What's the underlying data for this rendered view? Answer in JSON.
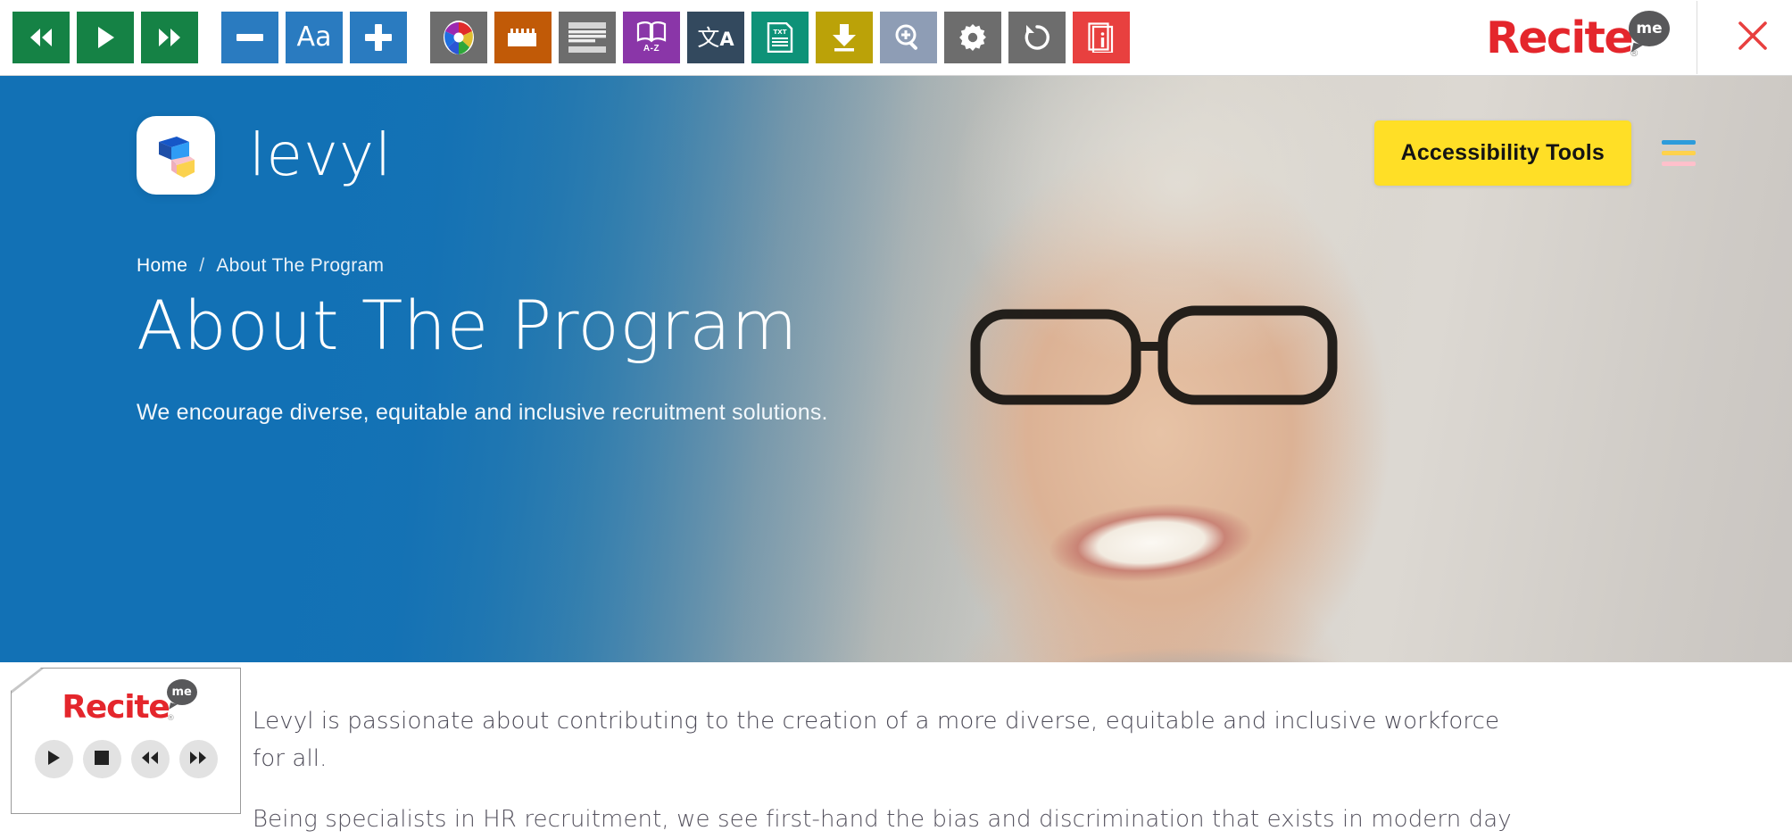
{
  "toolbar": {
    "name": "recite-me-accessibility-toolbar",
    "buttons": [
      {
        "key": "rewind",
        "label": "Rewind",
        "icon": "rewind-icon",
        "color": "#158245"
      },
      {
        "key": "play",
        "label": "Play",
        "icon": "play-icon",
        "color": "#158245"
      },
      {
        "key": "forward",
        "label": "Forward",
        "icon": "fast-forward-icon",
        "color": "#158245"
      },
      {
        "key": "decrease_text",
        "label": "Decrease Text Size",
        "icon": "minus-icon",
        "color": "#2a7bc0"
      },
      {
        "key": "font",
        "label": "Aa",
        "icon": "font-aa-icon",
        "color": "#2a7bc0"
      },
      {
        "key": "increase_text",
        "label": "Increase Text Size",
        "icon": "plus-icon",
        "color": "#2a7bc0"
      },
      {
        "key": "colour",
        "label": "Change Colour",
        "icon": "colour-wheel-icon",
        "color": "#6d6d6d"
      },
      {
        "key": "ruler",
        "label": "Ruler",
        "icon": "ruler-icon",
        "color": "#c15a07"
      },
      {
        "key": "screen_mask",
        "label": "Screen Mask",
        "icon": "screen-mask-icon",
        "color": "#6d6d6d"
      },
      {
        "key": "dictionary",
        "label": "Dictionary",
        "icon": "dictionary-book-icon",
        "color": "#8a36a8",
        "sublabel": "A-Z"
      },
      {
        "key": "translate",
        "label": "Translate",
        "icon": "translate-icon",
        "color": "#33495e"
      },
      {
        "key": "plain_text",
        "label": "Plain Text Mode",
        "icon": "plain-text-txt-icon",
        "color": "#0e9278",
        "sublabel": "TXT"
      },
      {
        "key": "download_audio",
        "label": "Download Audio",
        "icon": "download-icon",
        "color": "#bba208"
      },
      {
        "key": "magnifier",
        "label": "Magnifier",
        "icon": "magnifier-plus-icon",
        "color": "#8e9db5"
      },
      {
        "key": "settings",
        "label": "Settings",
        "icon": "gear-icon",
        "color": "#6d6d6d"
      },
      {
        "key": "reset",
        "label": "Reset",
        "icon": "reset-icon",
        "color": "#6d6d6d"
      },
      {
        "key": "user_guide",
        "label": "User Guide",
        "icon": "user-guide-info-icon",
        "color": "#e8403f"
      }
    ],
    "brand": {
      "wordmark": "Recite",
      "bubble": "me",
      "registered": "®",
      "color": "#e4262c"
    },
    "close_label": "Close accessibility toolbar"
  },
  "site": {
    "brand_name": "levyl",
    "logo_colors": {
      "dark_blue": "#1657c8",
      "light_blue": "#2f9cf5",
      "pink": "#f8c2cb",
      "yellow": "#fbd24e"
    },
    "accessibility_button": "Accessibility Tools",
    "menu_bar_colors": {
      "bar1": "#2d9cdb",
      "bar2": "#ffd24c",
      "bar3": "#ffc0cb"
    },
    "accent_yellow": "#ffdf26",
    "hero_blue": "#1271b5"
  },
  "breadcrumb": {
    "home": "Home",
    "separator": "/",
    "current": "About The Program"
  },
  "hero": {
    "title": "About The Program",
    "subtitle": "We encourage diverse, equitable and inclusive recruitment solutions."
  },
  "body": {
    "paragraph_1": "Levyl is passionate about contributing to the creation of a more diverse, equitable and inclusive workforce for all.",
    "paragraph_2": "Being specialists in HR recruitment, we see first-hand the bias and discrimination that exists in modern day"
  },
  "player": {
    "wordmark": "Recite",
    "bubble": "me",
    "registered": "®",
    "controls": [
      {
        "key": "play",
        "label": "Play",
        "icon": "play-icon"
      },
      {
        "key": "stop",
        "label": "Stop",
        "icon": "stop-icon"
      },
      {
        "key": "rewind",
        "label": "Rewind",
        "icon": "rewind-icon"
      },
      {
        "key": "forward",
        "label": "Forward",
        "icon": "fast-forward-icon"
      }
    ]
  }
}
